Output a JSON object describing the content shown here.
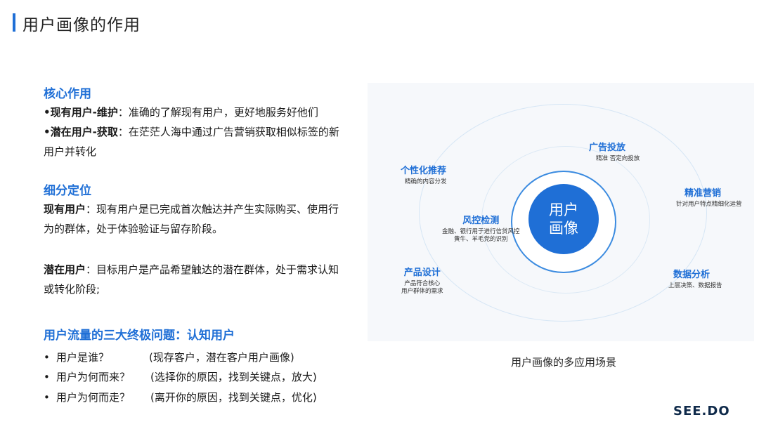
{
  "page_title": "用户画像的作用",
  "core_section": {
    "heading": "核心作用",
    "item1_label": "•现有用户-维护",
    "item1_text": "：准确的了解现有用户，更好地服务好他们",
    "item2_label": "•潜在用户-获取",
    "item2_text_line1": "：在茫茫人海中通过广告营销获取相似标签的新",
    "item2_text_line2": "用户并转化"
  },
  "segment_section": {
    "heading": "细分定位",
    "existing_label": "现有用户",
    "existing_text_line1": "：现有用户是已完成首次触达并产生实际购买、使用行",
    "existing_text_line2": "为的群体，处于体验验证与留存阶段。",
    "potential_label": "潜在用户",
    "potential_text_line1": "：目标用户是产品希望触达的潜在群体，处于需求认知",
    "potential_text_line2": "或转化阶段;"
  },
  "questions_section": {
    "heading": "用户流量的三大终极问题：认知用户",
    "items": [
      {
        "bullet": "•",
        "q": "用户是谁？",
        "note": "(现存客户，潜在客户用户画像)"
      },
      {
        "bullet": "•",
        "q": "用户为何而来？",
        "note": "(选择你的原因，找到关键点，放大)"
      },
      {
        "bullet": "•",
        "q": "用户为何而走？",
        "note": "(离开你的原因，找到关键点，优化)"
      }
    ]
  },
  "diagram": {
    "center_line1": "用户",
    "center_line2": "画像",
    "nodes": [
      {
        "title": "广告投放",
        "desc_line1": "精准    否定向投放",
        "desc_line2": ""
      },
      {
        "title": "个性化推荐",
        "desc_line1": "精确的内容分发",
        "desc_line2": ""
      },
      {
        "title": "精准营销",
        "desc_line1": "针对用户特点精细化运营",
        "desc_line2": ""
      },
      {
        "title": "风控检测",
        "desc_line1": "金融、银行用于进行信贷风控",
        "desc_line2": "黄牛、羊毛党的识别"
      },
      {
        "title": "产品设计",
        "desc_line1": "产品符合核心",
        "desc_line2": "用户群体的需求"
      },
      {
        "title": "数据分析",
        "desc_line1": "上层决策、数据报告",
        "desc_line2": ""
      }
    ],
    "caption": "用户画像的多应用场景"
  },
  "brand": "SEE.DO",
  "colors": {
    "accent": "#1f6fd6",
    "text": "#1a1a1a"
  }
}
